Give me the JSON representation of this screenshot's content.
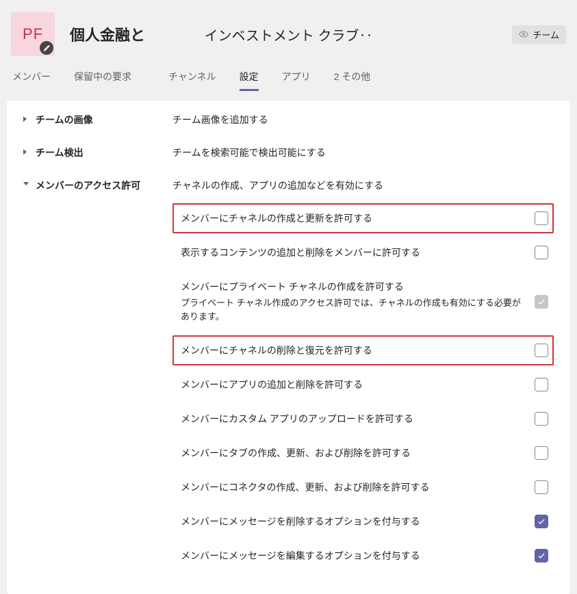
{
  "header": {
    "avatar_text": "PF",
    "team_name": "個人金融と",
    "subtitle": "インベストメント クラブ‥",
    "team_pill": "チーム"
  },
  "tabs": {
    "members": "メンバー",
    "pending": "保留中の要求",
    "channels": "チャンネル",
    "settings": "設定",
    "apps": "アプリ",
    "more": "2 その他"
  },
  "sections": {
    "team_image": {
      "title": "チームの画像",
      "desc": "チーム画像を追加する"
    },
    "team_discovery": {
      "title": "チーム検出",
      "desc": "チームを検索可能で検出可能にする"
    },
    "permissions": {
      "title": "メンバーのアクセス許可",
      "desc": "チャネルの作成、アプリの追加などを有効にする",
      "rows": [
        {
          "label": "メンバーにチャネルの作成と更新を許可する",
          "checked": false,
          "highlight": true
        },
        {
          "label": "表示するコンテンツの追加と削除をメンバーに許可する",
          "checked": false
        },
        {
          "label": "メンバーにプライベート チャネルの作成を許可する",
          "sublabel": "プライベート チャネル作成のアクセス許可では、チャネルの作成も有効にする必要があります。",
          "checked": true,
          "disabled": true
        },
        {
          "label": "メンバーにチャネルの削除と復元を許可する",
          "checked": false,
          "highlight": true
        },
        {
          "label": "メンバーにアプリの追加と削除を許可する",
          "checked": false
        },
        {
          "label": "メンバーにカスタム アプリのアップロードを許可する",
          "checked": false
        },
        {
          "label": "メンバーにタブの作成、更新、および削除を許可する",
          "checked": false
        },
        {
          "label": "メンバーにコネクタの作成、更新、および削除を許可する",
          "checked": false
        },
        {
          "label": "メンバーにメッセージを削除するオプションを付与する",
          "checked": true
        },
        {
          "label": "メンバーにメッセージを編集するオプションを付与する",
          "checked": true
        }
      ]
    }
  }
}
